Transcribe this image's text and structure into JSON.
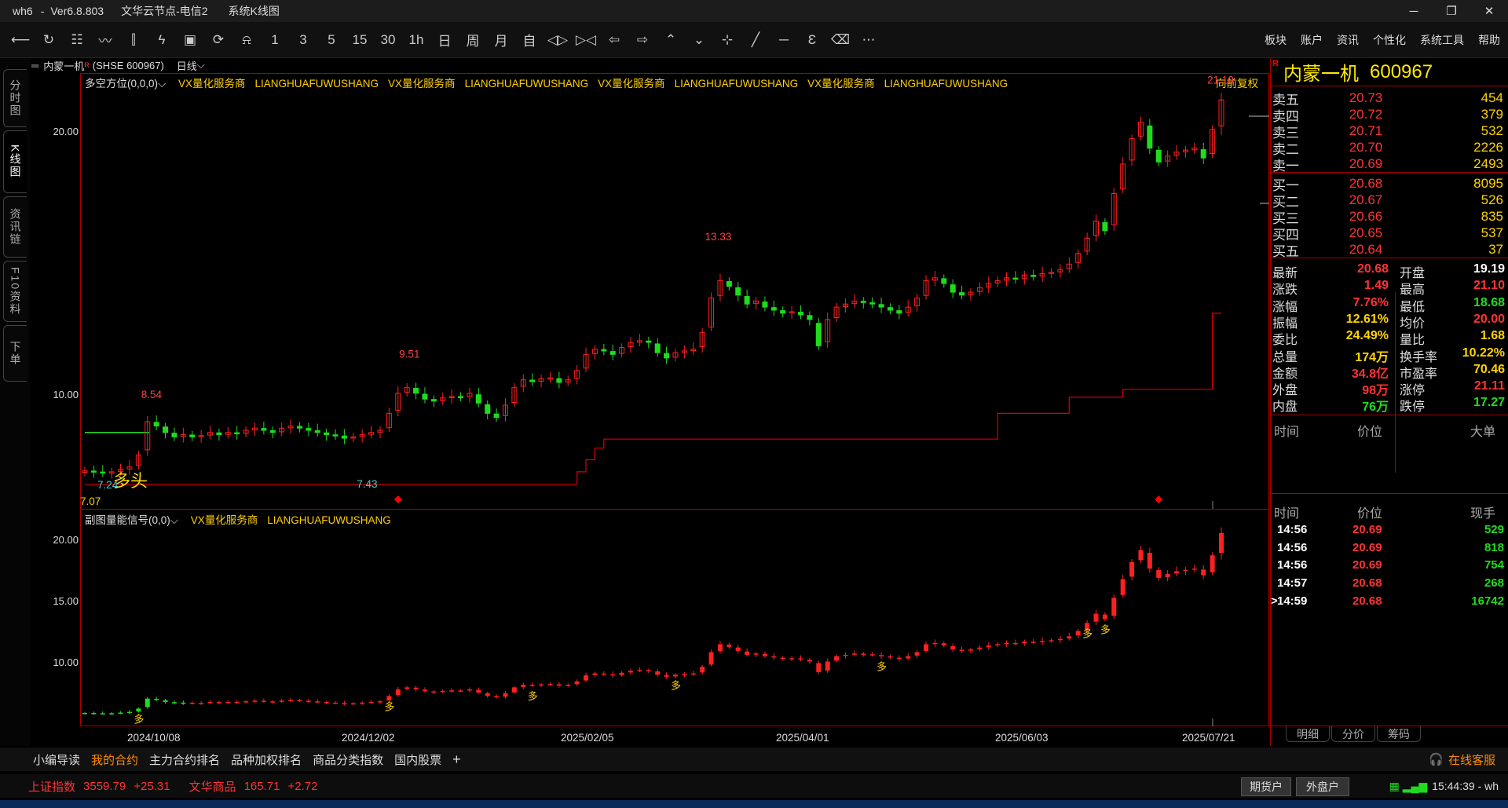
{
  "titlebar": {
    "app": "wh6",
    "sep": "-",
    "version": "Ver6.8.803",
    "node": "文华云节点-电信2",
    "view": "系统K线图"
  },
  "winbtns": {
    "minimize": "─",
    "restore": "❐",
    "close": "✕"
  },
  "toolbar": {
    "items": [
      {
        "name": "back-icon",
        "glyph": "⟵"
      },
      {
        "name": "refresh-icon",
        "glyph": "↻"
      },
      {
        "name": "table-icon",
        "glyph": "☷"
      },
      {
        "name": "line-chart-icon",
        "glyph": "〰"
      },
      {
        "name": "candlestick-icon",
        "glyph": "⫿"
      },
      {
        "name": "indicator-icon",
        "glyph": "ϟ"
      },
      {
        "name": "chip-icon",
        "glyph": "▣"
      },
      {
        "name": "sync-icon",
        "glyph": "⟳"
      },
      {
        "name": "bell-icon",
        "glyph": "⍾"
      },
      {
        "name": "period-1m",
        "glyph": "1"
      },
      {
        "name": "period-3m",
        "glyph": "3"
      },
      {
        "name": "period-5m",
        "glyph": "5"
      },
      {
        "name": "period-15m",
        "glyph": "15"
      },
      {
        "name": "period-30m",
        "glyph": "30"
      },
      {
        "name": "period-1h",
        "glyph": "1h"
      },
      {
        "name": "period-day",
        "glyph": "日"
      },
      {
        "name": "period-week",
        "glyph": "周"
      },
      {
        "name": "period-month",
        "glyph": "月"
      },
      {
        "name": "period-custom",
        "glyph": "自"
      },
      {
        "name": "zoom-in-icon",
        "glyph": "◁▷"
      },
      {
        "name": "zoom-out-icon",
        "glyph": "▷◁"
      },
      {
        "name": "left-arrow-icon",
        "glyph": "⇦"
      },
      {
        "name": "right-arrow-icon",
        "glyph": "⇨"
      },
      {
        "name": "up-icon",
        "glyph": "⌃"
      },
      {
        "name": "down-icon",
        "glyph": "⌄"
      },
      {
        "name": "crosshair-icon",
        "glyph": "⊹"
      },
      {
        "name": "draw-line-icon",
        "glyph": "╱"
      },
      {
        "name": "hline-icon",
        "glyph": "─"
      },
      {
        "name": "text-icon",
        "glyph": "Ɛ"
      },
      {
        "name": "eraser-icon",
        "glyph": "⌫"
      },
      {
        "name": "more-icon",
        "glyph": "⋯"
      }
    ]
  },
  "menu": [
    "板块",
    "账户",
    "资讯",
    "个性化",
    "系统工具",
    "帮助"
  ],
  "sidetabs": [
    "分时图",
    "K线图",
    "资讯链",
    "F10资料",
    "下单"
  ],
  "infobar": {
    "name": "内蒙一机",
    "sup": "R",
    "code": "(SHSE 600967)",
    "period": "日线",
    "caret": "⌵"
  },
  "main_chart": {
    "indicator": "多空方位(0,0,0)⌵",
    "tags": [
      "VX量化服务商",
      "LIANGHUAFUWUSHANG",
      "VX量化服务商",
      "LIANGHUAFUWUSHANG",
      "VX量化服务商",
      "LIANGHUAFUWUSHANG",
      "VX量化服务商",
      "LIANGHUAFUWUSHANG"
    ],
    "fuquan": "向前复权",
    "y_ticks": [
      "20.00",
      "10.00"
    ],
    "annotations": {
      "p854": "8.54",
      "p951": "9.51",
      "p1333": "13.33",
      "p2110": "21.10",
      "p743": "7.43",
      "p724": "7.24",
      "p707": "7.07",
      "duotou": "多头"
    }
  },
  "sub_chart": {
    "indicator": "副图量能信号(0,0)⌵",
    "tags": [
      "VX量化服务商",
      "LIANGHUAFUWUSHANG"
    ],
    "y_ticks": [
      "20.00",
      "15.00",
      "10.00"
    ],
    "signal": "多"
  },
  "x_axis": [
    "2024/10/08",
    "2024/12/02",
    "2025/02/05",
    "2025/04/01",
    "2025/06/03",
    "2025/07/21"
  ],
  "chart_data": {
    "type": "candlestick",
    "title": "内蒙一机 600967 日线",
    "ylim": [
      6.5,
      21.5
    ],
    "scale": "log",
    "x_ticks": [
      "2024/10/08",
      "2024/12/02",
      "2025/02/05",
      "2025/04/01",
      "2025/06/03",
      "2025/07/21"
    ],
    "marked_prices": {
      "high_1": 8.54,
      "low_1": 7.43,
      "high_2": 9.51,
      "high_3": 13.33,
      "high_4": 21.1,
      "low_start": 7.24
    },
    "series": [
      {
        "name": "收盘",
        "values": [
          7.12,
          7.1,
          7.08,
          7.1,
          7.15,
          7.2,
          7.45,
          8.2,
          8.1,
          7.95,
          7.85,
          7.9,
          7.85,
          7.88,
          7.95,
          7.9,
          7.95,
          7.92,
          8.0,
          8.05,
          8.0,
          7.95,
          8.05,
          8.1,
          8.05,
          8.0,
          7.95,
          7.9,
          7.88,
          7.82,
          7.85,
          7.9,
          7.95,
          8.0,
          8.4,
          8.9,
          9.05,
          8.9,
          8.75,
          8.7,
          8.78,
          8.82,
          8.8,
          8.9,
          8.65,
          8.4,
          8.3,
          8.6,
          9.05,
          9.25,
          9.2,
          9.28,
          9.3,
          9.18,
          9.25,
          9.5,
          9.95,
          10.1,
          10.05,
          9.95,
          10.15,
          10.3,
          10.35,
          10.3,
          10.0,
          9.85,
          10.0,
          10.05,
          10.1,
          10.6,
          11.7,
          12.3,
          12.1,
          11.8,
          11.5,
          11.6,
          11.4,
          11.3,
          11.2,
          11.25,
          11.15,
          11.0,
          10.2,
          11.0,
          11.4,
          11.5,
          11.6,
          11.55,
          11.5,
          11.4,
          11.3,
          11.2,
          11.4,
          11.7,
          12.3,
          12.4,
          12.2,
          11.9,
          11.8,
          11.9,
          12.05,
          12.2,
          12.3,
          12.4,
          12.35,
          12.5,
          12.45,
          12.55,
          12.6,
          12.7,
          12.9,
          13.3,
          13.9,
          14.6,
          14.2,
          15.8,
          17.2,
          18.5,
          19.4,
          18.0,
          17.3,
          17.6,
          17.8,
          17.9,
          18.0,
          17.5,
          19.0,
          20.68
        ]
      }
    ]
  },
  "quote": {
    "name": "内蒙一机",
    "code": "600967",
    "badge": "R",
    "asks": [
      {
        "label": "卖五",
        "price": "20.73",
        "vol": "454"
      },
      {
        "label": "卖四",
        "price": "20.72",
        "vol": "379"
      },
      {
        "label": "卖三",
        "price": "20.71",
        "vol": "532"
      },
      {
        "label": "卖二",
        "price": "20.70",
        "vol": "2226"
      },
      {
        "label": "卖一",
        "price": "20.69",
        "vol": "2493"
      }
    ],
    "bids": [
      {
        "label": "买一",
        "price": "20.68",
        "vol": "8095"
      },
      {
        "label": "买二",
        "price": "20.67",
        "vol": "526"
      },
      {
        "label": "买三",
        "price": "20.66",
        "vol": "835"
      },
      {
        "label": "买四",
        "price": "20.65",
        "vol": "537"
      },
      {
        "label": "买五",
        "price": "20.64",
        "vol": "37"
      }
    ],
    "stats": [
      {
        "k1": "最新",
        "v1": "20.68",
        "c1": "red",
        "k2": "开盘",
        "v2": "19.19",
        "c2": "white"
      },
      {
        "k1": "涨跌",
        "v1": "1.49",
        "c1": "red",
        "k2": "最高",
        "v2": "21.10",
        "c2": "red"
      },
      {
        "k1": "涨幅",
        "v1": "7.76%",
        "c1": "red",
        "k2": "最低",
        "v2": "18.68",
        "c2": "green"
      },
      {
        "k1": "振幅",
        "v1": "12.61%",
        "c1": "yellow",
        "k2": "均价",
        "v2": "20.00",
        "c2": "red"
      },
      {
        "k1": "委比",
        "v1": "24.49%",
        "c1": "yellow",
        "k2": "量比",
        "v2": "1.68",
        "c2": "yellow"
      },
      {
        "k1": "总量",
        "v1": "174万",
        "c1": "yellow",
        "k2": "换手率",
        "v2": "10.22%",
        "c2": "yellow"
      },
      {
        "k1": "金额",
        "v1": "34.8亿",
        "c1": "red",
        "k2": "市盈率",
        "v2": "70.46",
        "c2": "yellow"
      },
      {
        "k1": "外盘",
        "v1": "98万",
        "c1": "red",
        "k2": "涨停",
        "v2": "21.11",
        "c2": "red"
      },
      {
        "k1": "内盘",
        "v1": "76万",
        "c1": "green",
        "k2": "跌停",
        "v2": "17.27",
        "c2": "green"
      }
    ],
    "big_orders_header": {
      "time": "时间",
      "price": "价位",
      "big": "大单"
    },
    "ticks_header": {
      "time": "时间",
      "price": "价位",
      "vol": "现手"
    },
    "ticks": [
      {
        "time": "14:56",
        "price": "20.69",
        "vol": "529",
        "vc": "green"
      },
      {
        "time": "14:56",
        "price": "20.69",
        "vol": "818",
        "vc": "green"
      },
      {
        "time": "14:56",
        "price": "20.69",
        "vol": "754",
        "vc": "green"
      },
      {
        "time": "14:57",
        "price": "20.68",
        "vol": "268",
        "vc": "green"
      },
      {
        "time": "14:59",
        "price": "20.68",
        "vol": "16742",
        "vc": "green",
        "marker": ">"
      }
    ],
    "tabs": [
      "明细",
      "分价",
      "筹码"
    ]
  },
  "bottom_tabs": {
    "items": [
      "小编导读",
      "我的合约",
      "主力合约排名",
      "品种加权排名",
      "商品分类指数",
      "国内股票"
    ],
    "active": 1,
    "add": "+"
  },
  "online_service": "在线客服",
  "statusbar": {
    "idx1_name": "上证指数",
    "idx1_val": "3559.79",
    "idx1_chg": "+25.31",
    "idx2_name": "文华商品",
    "idx2_val": "165.71",
    "idx2_chg": "+2.72",
    "btn1": "期货户",
    "btn2": "外盘户",
    "clock": "15:44:39 - wh"
  },
  "colors": {
    "up": "#ff2020",
    "down": "#1fdc1f",
    "accent": "#ffcf00",
    "frame": "#aa0000"
  }
}
